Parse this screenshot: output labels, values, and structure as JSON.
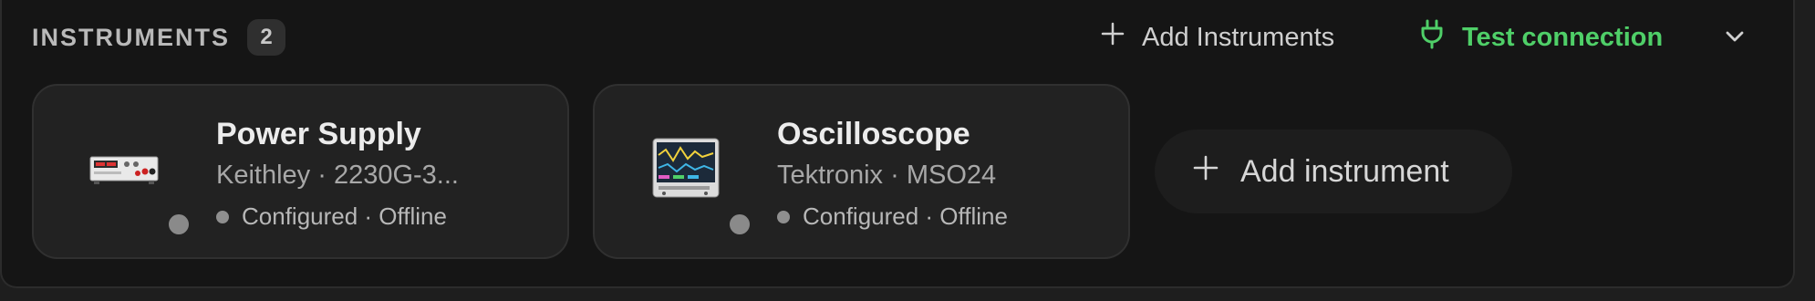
{
  "header": {
    "title": "INSTRUMENTS",
    "count": "2",
    "add_instruments_label": "Add Instruments",
    "test_connection_label": "Test connection"
  },
  "instruments": [
    {
      "name": "Power Supply",
      "subtitle": "Keithley · 2230G-3...",
      "status": "Configured · Offline",
      "icon": "power-supply-icon"
    },
    {
      "name": "Oscilloscope",
      "subtitle": "Tektronix · MSO24",
      "status": "Configured · Offline",
      "icon": "oscilloscope-icon"
    }
  ],
  "add_instrument_label": "Add instrument",
  "colors": {
    "accent_green": "#4fcf68",
    "panel_bg": "#151515",
    "card_bg": "#222222",
    "offline_dot": "#8f8f8f"
  }
}
